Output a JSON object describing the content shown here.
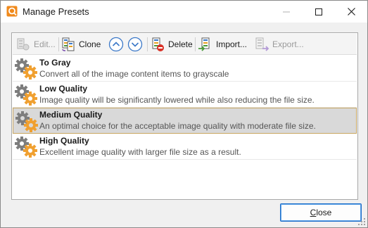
{
  "window": {
    "title": "Manage Presets"
  },
  "toolbar": {
    "edit_label": "Edit...",
    "clone_label": "Clone",
    "delete_label": "Delete",
    "import_label": "Import...",
    "export_label": "Export..."
  },
  "presets": [
    {
      "name": "To Gray",
      "description": "Convert all of the image content items to grayscale",
      "selected": false
    },
    {
      "name": "Low Quality",
      "description": "Image quality will be significantly lowered while also reducing the file size.",
      "selected": false
    },
    {
      "name": "Medium Quality",
      "description": "An optimal choice for the acceptable image quality with moderate file size.",
      "selected": true
    },
    {
      "name": "High Quality",
      "description": "Excellent image quality with larger file size as a result.",
      "selected": false
    }
  ],
  "footer": {
    "close_label_underlined": "C",
    "close_label_rest": "lose"
  },
  "colors": {
    "accent_border": "#1e6fc9",
    "selection_bg": "#d9d9d9",
    "selection_border": "#c8a660",
    "gear_gray": "#7d7d7d",
    "gear_orange": "#f0a030"
  },
  "icons": {
    "app": "pdf-xchange-icon",
    "gear": "gear-preset-icon"
  }
}
